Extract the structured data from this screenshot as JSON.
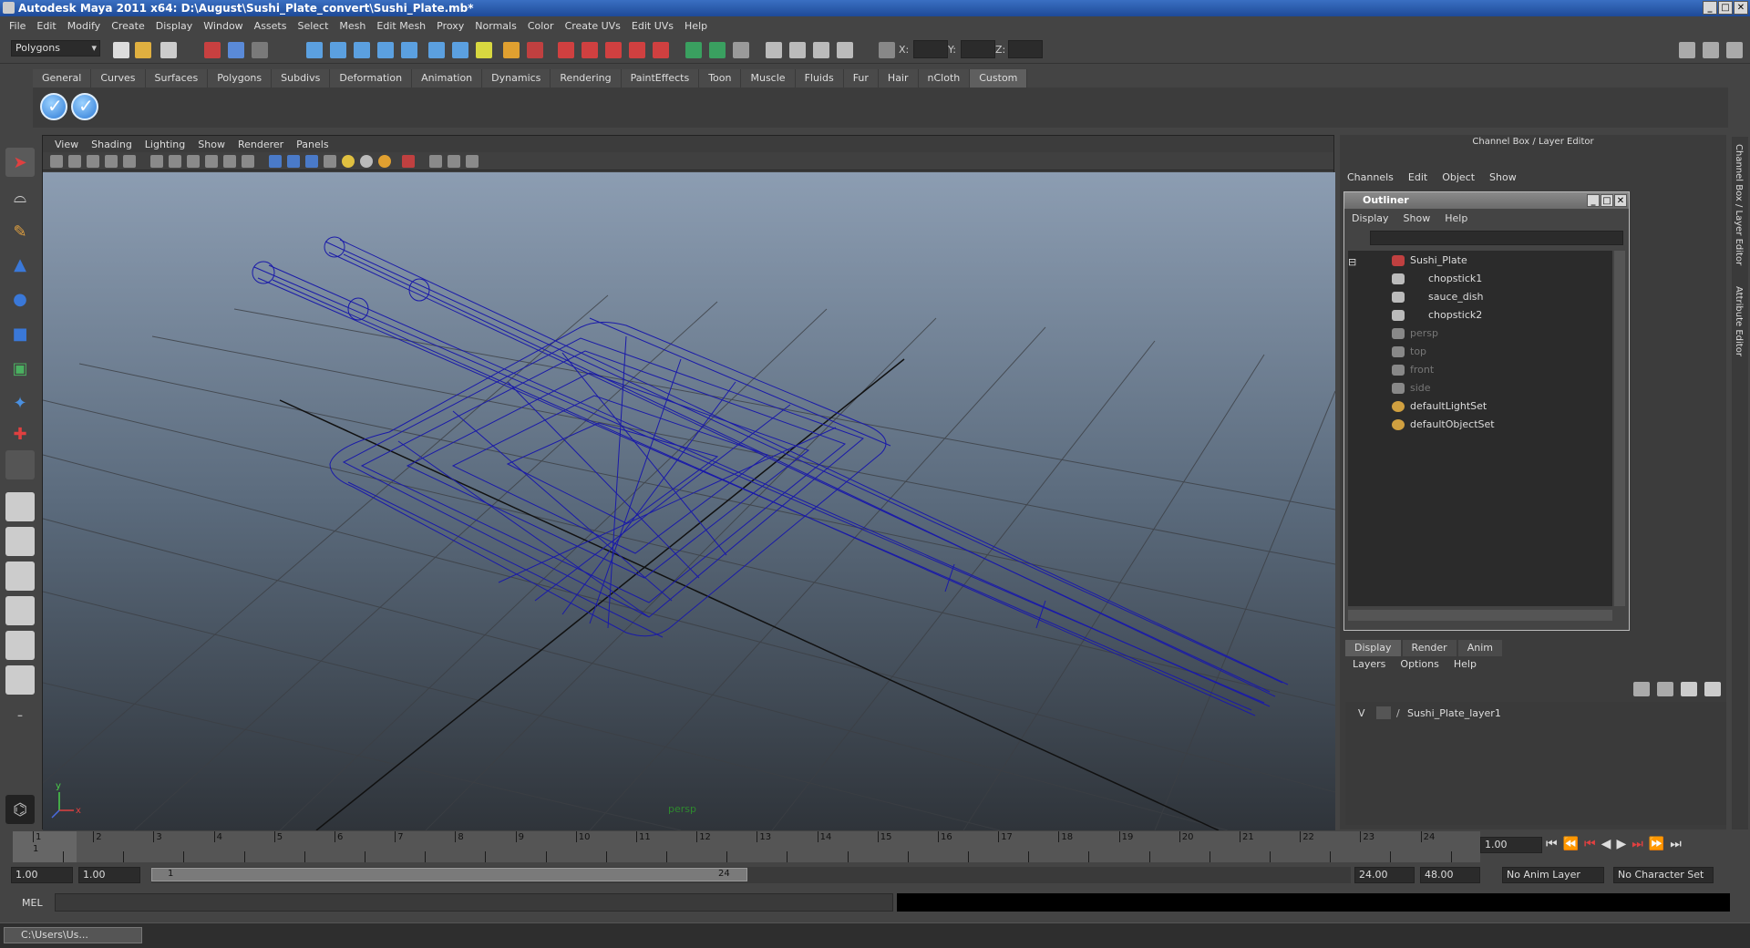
{
  "window": {
    "title": "Autodesk Maya 2011 x64: D:\\August\\Sushi_Plate_convert\\Sushi_Plate.mb*"
  },
  "menubar": [
    "File",
    "Edit",
    "Modify",
    "Create",
    "Display",
    "Window",
    "Assets",
    "Select",
    "Mesh",
    "Edit Mesh",
    "Proxy",
    "Normals",
    "Color",
    "Create UVs",
    "Edit UVs",
    "Help"
  ],
  "toolbar": {
    "mode": "Polygons",
    "x_label": "X:",
    "y_label": "Y:",
    "z_label": "Z:"
  },
  "shelf": {
    "tabs": [
      "General",
      "Curves",
      "Surfaces",
      "Polygons",
      "Subdivs",
      "Deformation",
      "Animation",
      "Dynamics",
      "Rendering",
      "PaintEffects",
      "Toon",
      "Muscle",
      "Fluids",
      "Fur",
      "Hair",
      "nCloth",
      "Custom"
    ],
    "active_tab": "Custom"
  },
  "viewport": {
    "menu": [
      "View",
      "Shading",
      "Lighting",
      "Show",
      "Renderer",
      "Panels"
    ],
    "camera_label": "persp",
    "axis_y": "y",
    "axis_x": "x"
  },
  "channel_box": {
    "title": "Channel Box / Layer Editor",
    "menu": [
      "Channels",
      "Edit",
      "Object",
      "Show"
    ],
    "side_tabs": [
      "Channel Box / Layer Editor",
      "Attribute Editor"
    ]
  },
  "outliner": {
    "title": "Outliner",
    "menu": [
      "Display",
      "Show",
      "Help"
    ],
    "items": [
      {
        "label": "Sushi_Plate",
        "indent": 0,
        "dim": false
      },
      {
        "label": "chopstick1",
        "indent": 1,
        "dim": false
      },
      {
        "label": "sauce_dish",
        "indent": 1,
        "dim": false
      },
      {
        "label": "chopstick2",
        "indent": 1,
        "dim": false
      },
      {
        "label": "persp",
        "indent": 0,
        "dim": true
      },
      {
        "label": "top",
        "indent": 0,
        "dim": true
      },
      {
        "label": "front",
        "indent": 0,
        "dim": true
      },
      {
        "label": "side",
        "indent": 0,
        "dim": true
      },
      {
        "label": "defaultLightSet",
        "indent": 0,
        "dim": false
      },
      {
        "label": "defaultObjectSet",
        "indent": 0,
        "dim": false
      }
    ]
  },
  "layers": {
    "tabs": [
      "Display",
      "Render",
      "Anim"
    ],
    "active_tab": "Display",
    "menu": [
      "Layers",
      "Options",
      "Help"
    ],
    "rows": [
      {
        "visible": "V",
        "name": "Sushi_Plate_layer1"
      }
    ]
  },
  "timeline": {
    "ticks": [
      "1",
      "2",
      "3",
      "4",
      "5",
      "6",
      "7",
      "8",
      "9",
      "10",
      "11",
      "12",
      "13",
      "14",
      "15",
      "16",
      "17",
      "18",
      "19",
      "20",
      "21",
      "22",
      "23",
      "24"
    ],
    "current_frame": "1",
    "current_time": "1.00"
  },
  "range": {
    "start": "1.00",
    "playback_start": "1.00",
    "slider_start": "1",
    "slider_end": "24",
    "playback_end": "24.00",
    "end": "48.00",
    "anim_layer": "No Anim Layer",
    "character_set": "No Character Set"
  },
  "mel": {
    "label": "MEL"
  },
  "taskbar": {
    "item": "C:\\Users\\Us..."
  },
  "colors": {
    "wireframe": "#1a1aa8",
    "title_bar": "#2a5bb0"
  }
}
